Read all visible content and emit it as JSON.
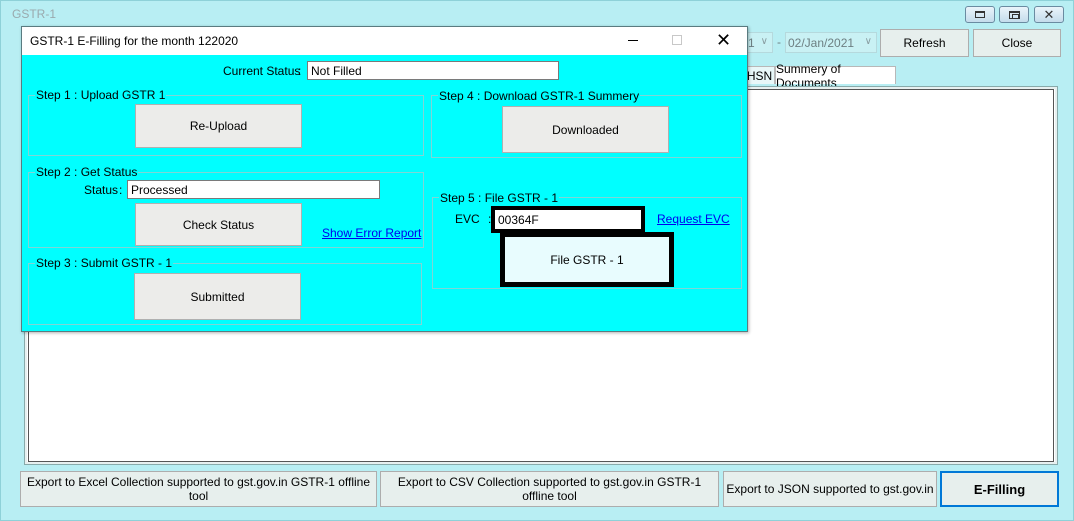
{
  "main": {
    "title": "GSTR-1",
    "from_date_partial": "1",
    "date_separator": "-",
    "to_date": "02/Jan/2021",
    "refresh_label": "Refresh",
    "close_label": "Close",
    "tabs": [
      {
        "label": "HSN"
      },
      {
        "label": "Summery of Documents"
      }
    ],
    "bottom_buttons": {
      "excel": "Export to Excel Collection supported to gst.gov.in GSTR-1 offline tool",
      "csv": "Export to CSV Collection supported to gst.gov.in GSTR-1 offline tool",
      "json": "Export to JSON supported to gst.gov.in",
      "efilling": "E-Filling"
    }
  },
  "dialog": {
    "title": "GSTR-1 E-Filling for the month 122020",
    "current_status_label": "Current Status",
    "colon": ":",
    "current_status_value": "Not Filled",
    "step1": {
      "legend": "Step 1 : Upload GSTR 1",
      "button": "Re-Upload"
    },
    "step2": {
      "legend": "Step 2 : Get Status",
      "status_label": "Status",
      "status_value": "Processed",
      "button": "Check Status",
      "error_link": "Show Error Report"
    },
    "step3": {
      "legend": "Step 3 : Submit GSTR - 1",
      "button": "Submitted"
    },
    "step4": {
      "legend": "Step 4 : Download GSTR-1 Summery",
      "button": "Downloaded"
    },
    "step5": {
      "legend": "Step 5 : File GSTR - 1",
      "evc_label": "EVC",
      "evc_value": "00364F",
      "request_link": "Request EVC",
      "button": "File GSTR - 1"
    }
  },
  "colors": {
    "dialog_bg": "#00ffff",
    "main_bg": "#b8eef3",
    "link": "#0000ee",
    "focus_border": "#0078d7"
  },
  "icons": [
    "minimize-icon",
    "maximize-icon",
    "close-icon",
    "chevron-down-icon"
  ]
}
